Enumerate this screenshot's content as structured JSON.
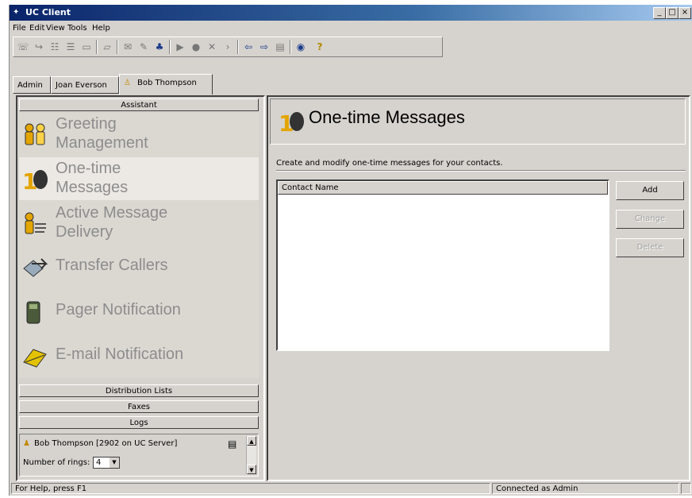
{
  "window": {
    "title": "UC Client",
    "controls": [
      "_",
      "□",
      "×"
    ]
  },
  "menu": [
    "File",
    "Edit",
    "View",
    "Tools",
    "Help"
  ],
  "toolbar_icons": [
    "new-call-icon",
    "forward-icon",
    "contacts-icon",
    "directory-icon",
    "mailbox-icon",
    "folder-icon",
    "message-icon",
    "properties-icon",
    "user-settings-icon",
    "play-icon",
    "record-icon",
    "delete-icon",
    "next-icon",
    "back-arrow-icon",
    "forward-arrow-icon",
    "page-icon",
    "refresh-icon",
    "help-icon"
  ],
  "tabs": {
    "admin": "Admin",
    "joan": "Joan Everson",
    "bob": "Bob Thompson"
  },
  "left": {
    "assistant_header": "Assistant",
    "items": [
      {
        "line1": "Greeting",
        "line2": "Management",
        "icon": "greeting-people-icon"
      },
      {
        "line1": "One-time",
        "line2": "Messages",
        "icon": "one-time-message-icon"
      },
      {
        "line1": "Active Message",
        "line2": "Delivery",
        "icon": "active-message-icon"
      },
      {
        "line1": "Transfer Callers",
        "line2": "",
        "icon": "transfer-callers-icon"
      },
      {
        "line1": "Pager Notification",
        "line2": "",
        "icon": "pager-icon"
      },
      {
        "line1": "E-mail Notification",
        "line2": "",
        "icon": "email-notification-icon"
      }
    ],
    "sections": [
      "Distribution Lists",
      "Faxes",
      "Logs"
    ],
    "status": {
      "user": "Bob Thompson [2902 on UC Server]",
      "rings_label": "Number of rings:",
      "rings_value": "4"
    }
  },
  "right": {
    "title": "One-time Messages",
    "description": "Create and modify one-time messages for your contacts.",
    "column_header": "Contact Name",
    "buttons": {
      "add": "Add",
      "change": "Change",
      "delete": "Delete"
    }
  },
  "statusbar": {
    "help": "For Help, press F1",
    "connection": "Connected as Admin"
  }
}
